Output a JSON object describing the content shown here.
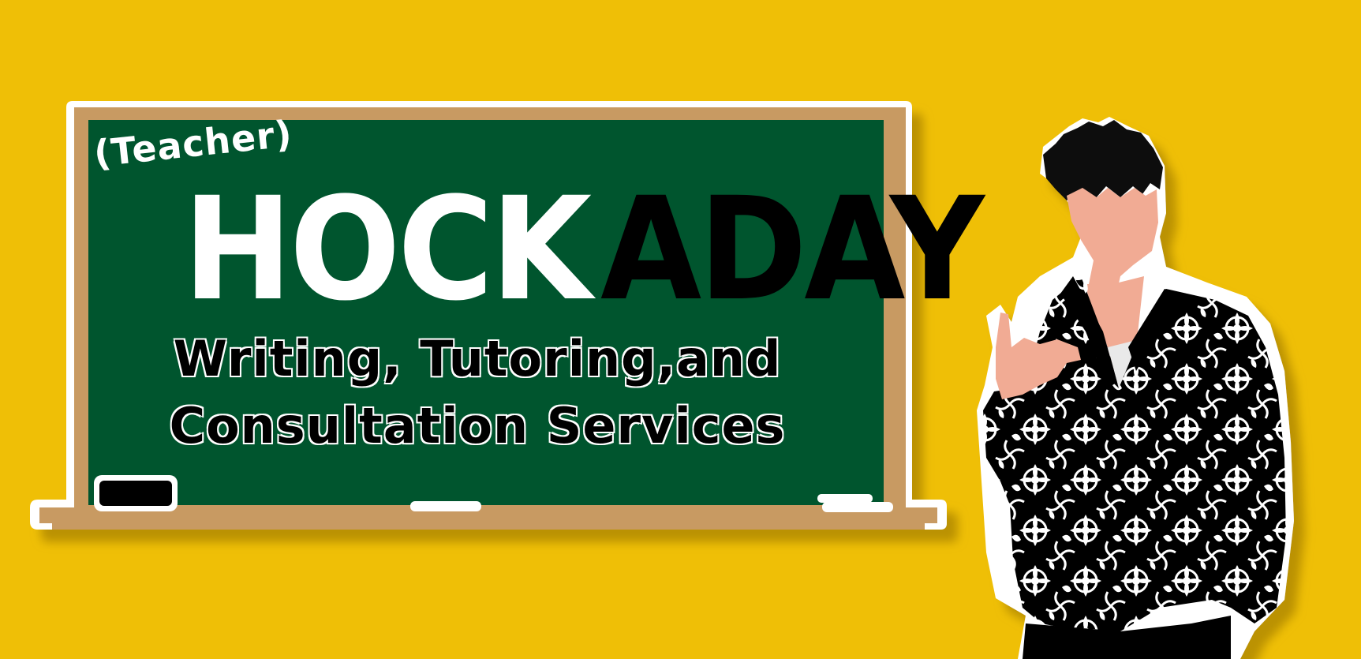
{
  "banner": {
    "eyebrow": "(Teacher)",
    "name_light": "HOCK",
    "name_dark": "ADAY",
    "tagline_line1": "Writing, Tutoring,and",
    "tagline_line2": "Consultation Services"
  },
  "colors": {
    "background": "#efbf06",
    "chalkboard": "#05552f",
    "frame": "#c89a62",
    "outline": "#ffffff",
    "skin": "#f1ab94",
    "jacket": "#000000"
  }
}
